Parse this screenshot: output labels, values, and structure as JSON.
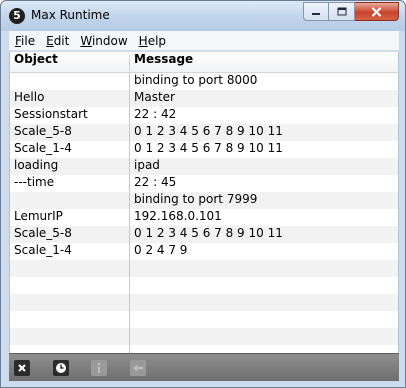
{
  "window": {
    "title": "Max Runtime",
    "app_icon_glyph": "5"
  },
  "menu": {
    "items": [
      {
        "mnemonic": "F",
        "rest": "ile"
      },
      {
        "mnemonic": "E",
        "rest": "dit"
      },
      {
        "mnemonic": "W",
        "rest": "indow"
      },
      {
        "mnemonic": "H",
        "rest": "elp"
      }
    ]
  },
  "table": {
    "columns": [
      "Object",
      "Message"
    ],
    "rows": [
      {
        "object": "",
        "message": "binding to port 8000"
      },
      {
        "object": "Hello",
        "message": "Master"
      },
      {
        "object": "Sessionstart",
        "message": "22 : 42"
      },
      {
        "object": "Scale_5-8",
        "message": "0 1 2 3 4 5 6 7 8 9 10 11"
      },
      {
        "object": "Scale_1-4",
        "message": "0 1 2 3 4 5 6 7 8 9 10 11"
      },
      {
        "object": "loading",
        "message": "ipad"
      },
      {
        "object": "---time",
        "message": "22 : 45"
      },
      {
        "object": "",
        "message": "binding to port 7999"
      },
      {
        "object": "LemurIP",
        "message": "192.168.0.101"
      },
      {
        "object": "Scale_5-8",
        "message": "0 1 2 3 4 5 6 7 8 9 10 11"
      },
      {
        "object": "Scale_1-4",
        "message": "0 2 4 7 9"
      },
      {
        "object": "",
        "message": ""
      },
      {
        "object": "",
        "message": ""
      },
      {
        "object": "",
        "message": ""
      },
      {
        "object": "",
        "message": ""
      },
      {
        "object": "",
        "message": ""
      }
    ]
  },
  "toolbar": {
    "buttons": [
      {
        "icon": "clear-icon",
        "enabled": true
      },
      {
        "icon": "clock-icon",
        "enabled": true
      },
      {
        "icon": "info-icon",
        "enabled": false
      },
      {
        "icon": "arrow-left-icon",
        "enabled": false
      }
    ]
  },
  "colors": {
    "close_button": "#c9442c",
    "frame": "#cbdcee"
  }
}
